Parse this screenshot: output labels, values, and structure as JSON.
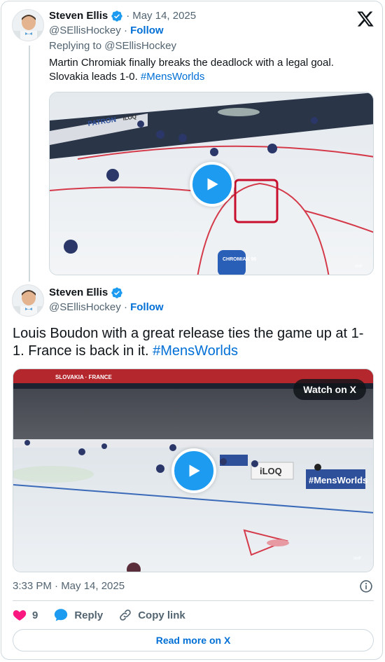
{
  "colors": {
    "accent": "#1d9bf0",
    "link": "#006fd6",
    "heart": "#f91880",
    "muted": "#536471",
    "border": "#cfd9de"
  },
  "icons": [
    "verified-badge-icon",
    "x-logo-icon",
    "play-icon",
    "info-icon",
    "heart-icon",
    "reply-bubble-icon",
    "link-icon"
  ],
  "quoted_tweet": {
    "author_name": "Steven Ellis",
    "date": "May 14, 2025",
    "dot": "·",
    "handle": "@SEllisHockey",
    "follow_label": "Follow",
    "replying_to": "Replying to @SEllisHockey",
    "text": "Martin Chromiak finally breaks the deadlock with a legal goal. Slovakia leads 1-0.",
    "hashtag": "#MensWorlds",
    "video": {
      "board_text_1": "PATRON",
      "board_text_2": "iLOQ",
      "jersey": "CHROMIAK 96",
      "watermark": "IIHF"
    }
  },
  "main_tweet": {
    "author_name": "Steven Ellis",
    "handle": "@SEllisHockey",
    "dot": "·",
    "follow_label": "Follow",
    "text": "Louis Boudon with a great release ties the game up at 1-1. France is back in it.",
    "hashtag": "#MensWorlds",
    "video": {
      "watch_label": "Watch on X",
      "board_text": "#MensWorlds",
      "board_text_2": "iLOQ",
      "board_text_3": "SLOVAKIA · FRANCE",
      "watermark": "IIHF"
    },
    "timestamp": "3:33 PM · May 14, 2025"
  },
  "actions": {
    "like_count": "9",
    "reply_label": "Reply",
    "copy_label": "Copy link"
  },
  "read_more_label": "Read more on X"
}
